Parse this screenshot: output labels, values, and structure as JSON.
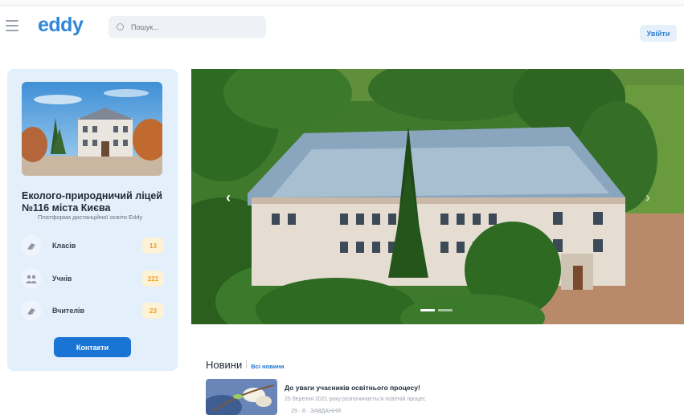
{
  "header": {
    "logo": "eddy",
    "search_placeholder": "Пошук...",
    "login_label": "Увійти"
  },
  "sidebar": {
    "school_name": "Еколого-природничий ліцей №116 міста Києва",
    "platform_subtitle": "Платформа дистанційної освіти Eddy",
    "stats": [
      {
        "label": "Класів",
        "value": "13",
        "icon": "book-icon"
      },
      {
        "label": "Учнів",
        "value": "221",
        "icon": "students-icon"
      },
      {
        "label": "Вчителів",
        "value": "23",
        "icon": "teacher-icon"
      }
    ],
    "contacts_label": "Контакти"
  },
  "carousel": {
    "prev_arrow": "‹",
    "next_arrow": "›",
    "slides_count": 2,
    "active_slide": 1
  },
  "news": {
    "title": "Новини",
    "all_link": "Всі новини",
    "items": [
      {
        "title": "До уваги учасників освітнього процесу!",
        "subtitle": "25 березня 2021 року розпочинається освітній процес",
        "meta": "29 · 8 · ЗАВДАННЯ"
      }
    ]
  },
  "colors": {
    "brand": "#2f86d9",
    "primary_button": "#1a74d4",
    "sidebar_bg": "#e3effa",
    "badge_bg": "#fdf1d6",
    "badge_text": "#f0a028"
  }
}
